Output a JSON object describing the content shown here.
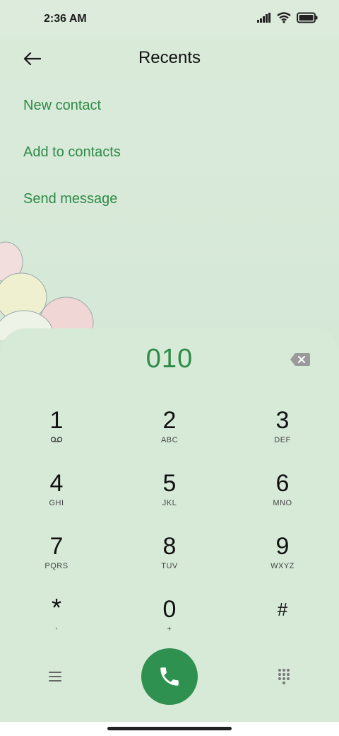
{
  "status_bar": {
    "time": "2:36 AM",
    "icons": [
      "signal-icon",
      "wifi-icon",
      "battery-icon"
    ]
  },
  "header": {
    "back_icon": "back-arrow-icon",
    "title": "Recents"
  },
  "menu": {
    "items": [
      {
        "label": "New contact"
      },
      {
        "label": "Add to contacts"
      },
      {
        "label": "Send message"
      }
    ]
  },
  "dialer": {
    "number": "010",
    "backspace_icon": "backspace-icon",
    "keys": [
      {
        "digit": "1",
        "letters": "",
        "icon": "voicemail-icon"
      },
      {
        "digit": "2",
        "letters": "ABC"
      },
      {
        "digit": "3",
        "letters": "DEF"
      },
      {
        "digit": "4",
        "letters": "GHI"
      },
      {
        "digit": "5",
        "letters": "JKL"
      },
      {
        "digit": "6",
        "letters": "MNO"
      },
      {
        "digit": "7",
        "letters": "PQRS"
      },
      {
        "digit": "8",
        "letters": "TUV"
      },
      {
        "digit": "9",
        "letters": "WXYZ"
      },
      {
        "digit": "*",
        "letters": ","
      },
      {
        "digit": "0",
        "letters": "+"
      },
      {
        "digit": "#",
        "letters": ""
      }
    ],
    "bottom": {
      "menu_icon": "menu-icon",
      "call_icon": "phone-icon",
      "dialpad_icon": "dialpad-icon"
    }
  },
  "colors": {
    "accent": "#2e8b46",
    "call_button": "#2e9150",
    "background": "#d5e8d7"
  }
}
